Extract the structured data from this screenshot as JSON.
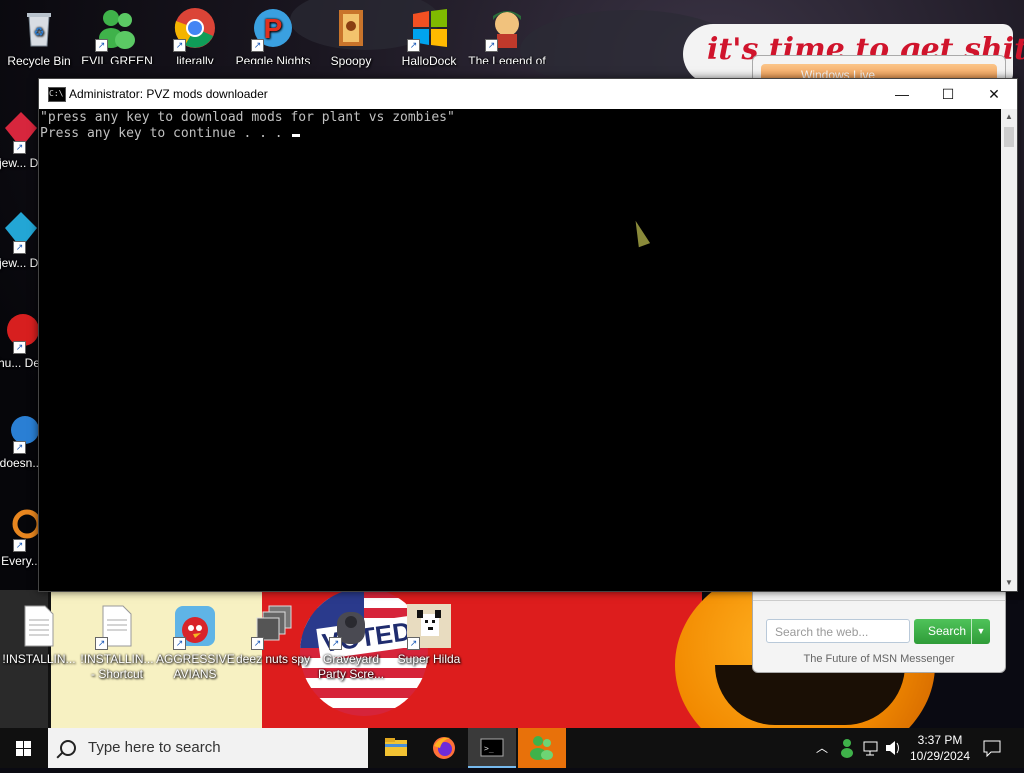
{
  "desktop": {
    "top_icons": [
      {
        "label": "Recycle Bin",
        "icon": "recycle-bin-icon"
      },
      {
        "label": "EVIL GREEN MEN CO...",
        "icon": "msn-buddies-icon"
      },
      {
        "label": "literally",
        "icon": "chrome-icon"
      },
      {
        "label": "Peggle Nights Del...",
        "icon": "peggle-icon"
      },
      {
        "label": "Spoopy",
        "icon": "spoopy-icon"
      },
      {
        "label": "HalloDock",
        "icon": "windows-logo-icon"
      },
      {
        "label": "The Legend of Tiki...",
        "icon": "legend-icon"
      }
    ],
    "left_icons": [
      {
        "label": "Bejew... Del...",
        "icon": "bejeweled-icon"
      },
      {
        "label": "Bejew... Del...",
        "icon": "bejeweled-2-icon"
      },
      {
        "label": "Chu... Del...",
        "icon": "chuzzle-icon"
      },
      {
        "label": "doesn...",
        "icon": "blue-app-icon"
      },
      {
        "label": "Every...",
        "icon": "orange-app-icon"
      }
    ],
    "bottom_icons": [
      {
        "label": "!INSTALLIN...",
        "icon": "text-document-icon"
      },
      {
        "label": "!INSTALLIN... - Shortcut",
        "icon": "text-document-shortcut-icon"
      },
      {
        "label": "AGGRESSIVE AVIANS",
        "icon": "angry-bird-icon"
      },
      {
        "label": "deez nuts spy",
        "icon": "stacked-windows-icon"
      },
      {
        "label": "Graveyard Party Scre...",
        "icon": "graveyard-icon"
      },
      {
        "label": "Super Hilda",
        "icon": "pixel-dog-icon"
      }
    ],
    "wallpaper_text": "it's time to get shit",
    "flag_text": "VOTED"
  },
  "messenger": {
    "bar_text": "Windows Live",
    "search_placeholder": "Search the web...",
    "search_button": "Search",
    "footer": "The Future of MSN Messenger"
  },
  "console": {
    "title": "Administrator:  PVZ mods downloader",
    "lines": [
      "\"press any key to download mods for plant vs zombies\"",
      "Press any key to continue . . . "
    ],
    "minimize": "—",
    "maximize": "☐",
    "close": "✕"
  },
  "taskbar": {
    "search_placeholder": "Type here to search",
    "time": "3:37 PM",
    "date": "10/29/2024",
    "pinned": [
      "file-explorer-icon",
      "firefox-icon",
      "command-prompt-icon",
      "msn-messenger-icon"
    ]
  }
}
